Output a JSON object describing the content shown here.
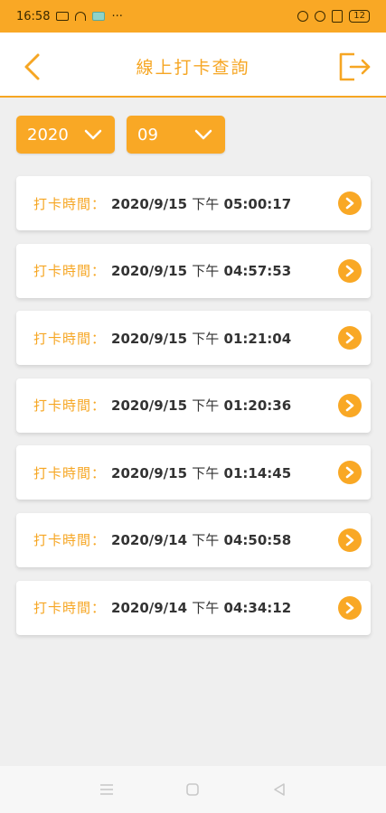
{
  "status_bar": {
    "time": "16:58",
    "battery": "12"
  },
  "header": {
    "title": "線上打卡查詢"
  },
  "filters": {
    "year": "2020",
    "month": "09"
  },
  "records": [
    {
      "label": "打卡時間：",
      "date": "2020/9/15",
      "ampm": "下午",
      "time": "05:00:17"
    },
    {
      "label": "打卡時間：",
      "date": "2020/9/15",
      "ampm": "下午",
      "time": "04:57:53"
    },
    {
      "label": "打卡時間：",
      "date": "2020/9/15",
      "ampm": "下午",
      "time": "01:21:04"
    },
    {
      "label": "打卡時間：",
      "date": "2020/9/15",
      "ampm": "下午",
      "time": "01:20:36"
    },
    {
      "label": "打卡時間：",
      "date": "2020/9/15",
      "ampm": "下午",
      "time": "01:14:45"
    },
    {
      "label": "打卡時間：",
      "date": "2020/9/14",
      "ampm": "下午",
      "time": "04:50:58"
    },
    {
      "label": "打卡時間：",
      "date": "2020/9/14",
      "ampm": "下午",
      "time": "04:34:12"
    }
  ],
  "colors": {
    "accent": "#f9a825",
    "title": "#f6a623",
    "text": "#333333"
  },
  "icons": {
    "back": "chevron-left-icon",
    "logout": "logout-icon",
    "dropdown": "chevron-down-icon",
    "row": "chevron-right-circle-icon"
  }
}
